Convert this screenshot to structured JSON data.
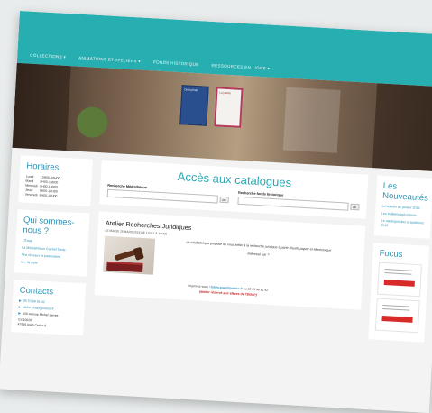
{
  "nav": {
    "items": [
      "COLLECTIONS ▾",
      "ANIMATIONS ET ATELIERS ▾",
      "FONDS HISTORIQUE",
      "RESSOURCES EN LIGNE ▾"
    ]
  },
  "hero": {
    "book1": "Droit pénal",
    "book2": "La justice"
  },
  "horaires": {
    "title": "Horaires",
    "rows": [
      {
        "day": "Lundi",
        "hours": "13H00-18H00"
      },
      {
        "day": "Mardi",
        "hours": "8H00-18H00"
      },
      {
        "day": "Mercredi",
        "hours": "8H00-18H00"
      },
      {
        "day": "Jeudi",
        "hours": "8H00-18H00"
      },
      {
        "day": "Vendredi",
        "hours": "8H00-18H00"
      }
    ]
  },
  "qui": {
    "title": "Qui sommes-nous ?",
    "links": [
      "L'Enap",
      "La Médiathèque Gabriel Tarde",
      "Nos réseaux et partenaires",
      "Lire la suite"
    ]
  },
  "contacts": {
    "title": "Contacts",
    "phone": "05 53 98 91 42",
    "email": "biblio.enap@justice.fr",
    "address_lines": [
      "440 avenue Michel Serres",
      "CS 10028",
      "47916 Agen Cedex 9"
    ]
  },
  "catalog": {
    "title": "Accès aux catalogues",
    "search1_label": "Recherche Médiathèque",
    "search2_label": "Recherche fonds historique",
    "button": "OK"
  },
  "article": {
    "title": "Atelier Recherches Juridiques",
    "date": "LE MARDI 26 MARS 2019 DE 17H15 À 18H00",
    "body": "La médiathèque propose de vous initier à la recherche juridique à partir d'outils papier et électronique",
    "question": "Intéressé par ?",
    "contact_prefix": "Inscrivez-vous ! ",
    "contact_email": "biblio.enap@justice.fr",
    "contact_suffix": " ou 05 53 98 91 42",
    "reserved": "(atelier réservé aux élèves de l'ENAP)"
  },
  "nouveautes": {
    "title": "Les Nouveautés",
    "links": [
      "Le bulletin de janvier 2019",
      "Les bulletins précédents",
      "Le catalogue des acquisitions 2018"
    ]
  },
  "focus": {
    "title": "Focus"
  },
  "colors": {
    "nav": "#27aeb0",
    "accent": "#2d93b8",
    "title_teal": "#2aa8b6",
    "red": "#c02a2a"
  }
}
